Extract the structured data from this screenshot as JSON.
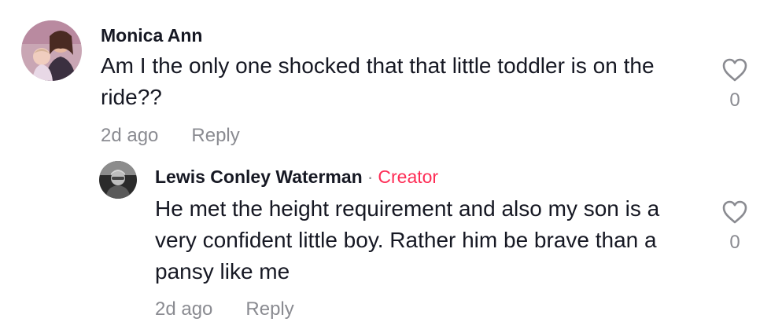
{
  "comments": [
    {
      "author": "Monica Ann",
      "text": "Am I the only one shocked that that little toddler is on the ride??",
      "time": "2d ago",
      "reply_label": "Reply",
      "likes": "0",
      "avatar_icon": "user-avatar",
      "like_icon": "heart-outline-icon"
    }
  ],
  "replies": [
    {
      "author": "Lewis Conley Waterman",
      "separator": "·",
      "badge": "Creator",
      "text": "He met the height requirement and also my son is a very confident little boy. Rather him be brave than a pansy like me",
      "time": "2d ago",
      "reply_label": "Reply",
      "likes": "0",
      "avatar_icon": "user-avatar",
      "like_icon": "heart-outline-icon"
    }
  ],
  "colors": {
    "text_primary": "#161823",
    "text_secondary": "#8a8b91",
    "creator_badge": "#fe2c55"
  }
}
